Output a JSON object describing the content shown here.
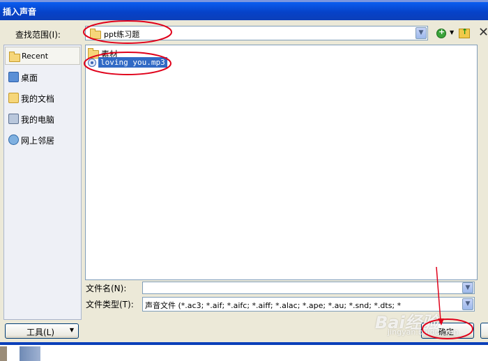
{
  "window": {
    "title": "插入声音"
  },
  "lookin": {
    "label": "查找范围(I):",
    "value": "ppt练习题"
  },
  "places": [
    {
      "label": "Recent",
      "icon": "recent-folder-icon"
    },
    {
      "label": "桌面",
      "icon": "desktop-icon"
    },
    {
      "label": "我的文档",
      "icon": "my-documents-icon"
    },
    {
      "label": "我的电脑",
      "icon": "my-computer-icon"
    },
    {
      "label": "网上邻居",
      "icon": "network-places-icon"
    }
  ],
  "files": [
    {
      "name": "素材",
      "icon": "folder-icon"
    },
    {
      "name": "loving you.mp3",
      "icon": "audio-file-icon",
      "selected": true
    }
  ],
  "filename": {
    "label": "文件名(N):",
    "value": ""
  },
  "filetype": {
    "label": "文件类型(T):",
    "value": "声音文件 (*.ac3; *.aif; *.aifc; *.aiff; *.alac; *.ape; *.au; *.snd; *.dts; *"
  },
  "buttons": {
    "tools": "工具(L)",
    "ok": "确定"
  },
  "watermark": {
    "brand": "Bai经验",
    "url": "jingyan.baidu.com"
  },
  "colors": {
    "titlebar": "#0a5ef0",
    "selection": "#316ac5",
    "annotation": "#e0001a"
  }
}
